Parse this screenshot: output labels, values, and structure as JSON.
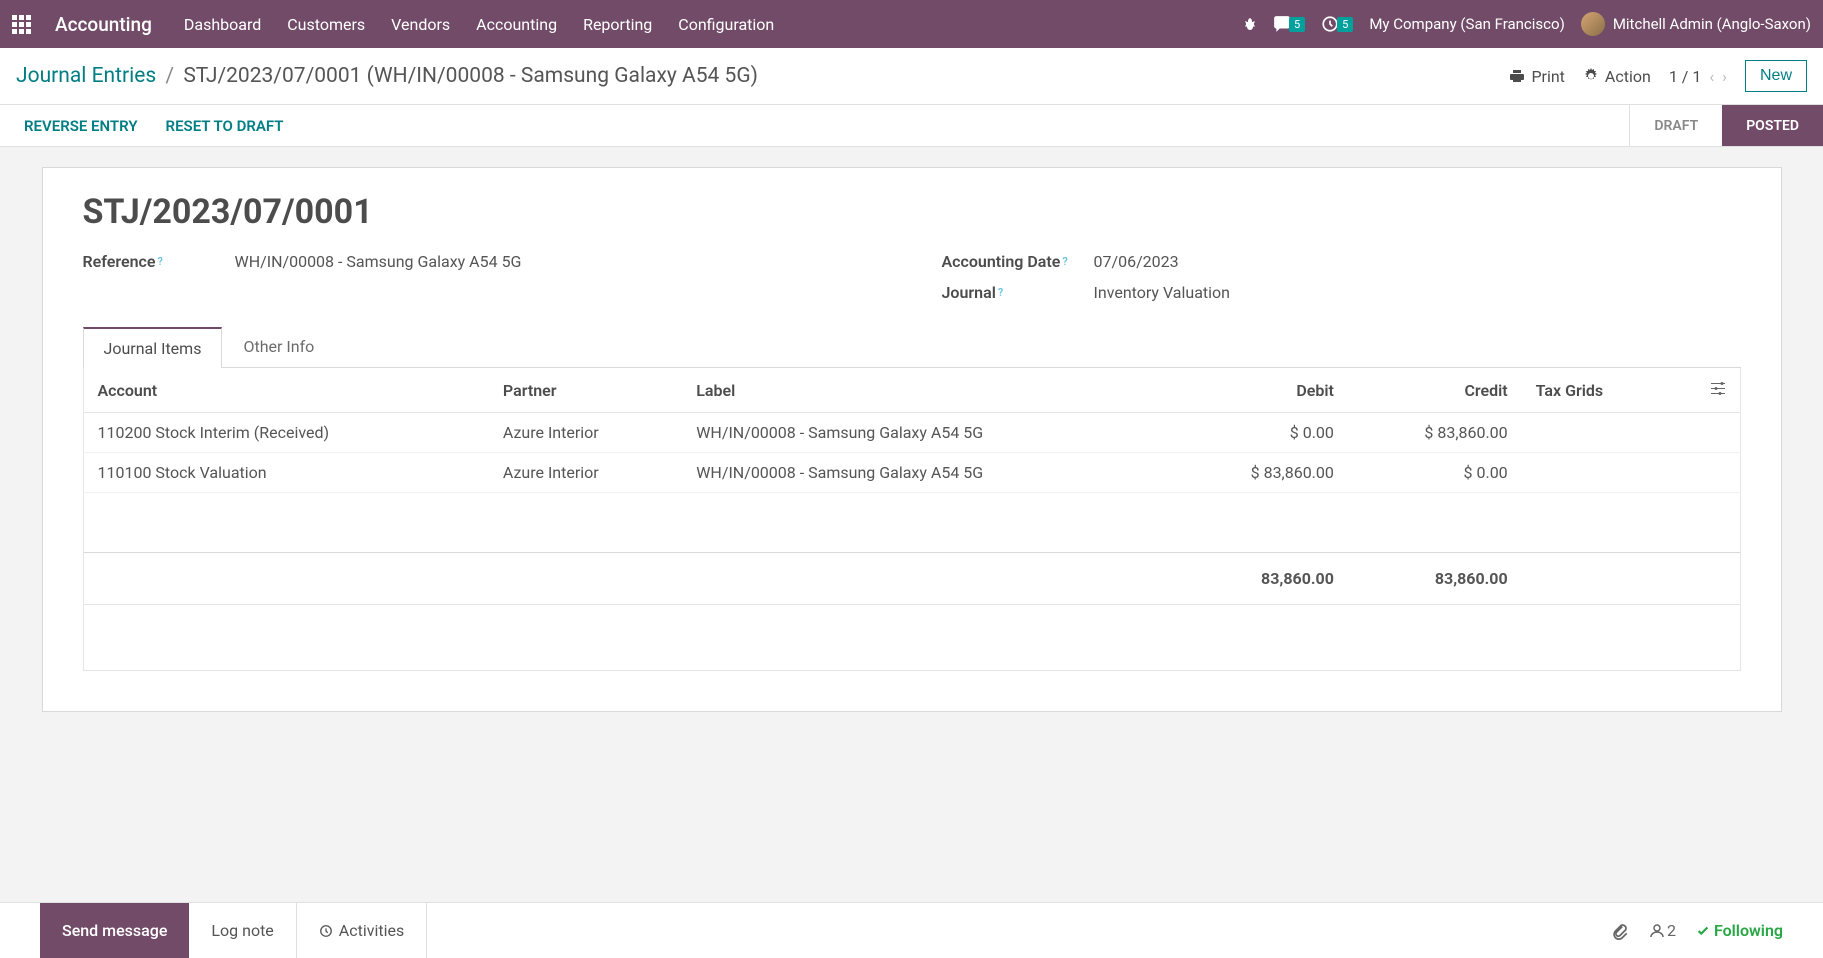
{
  "navbar": {
    "app_name": "Accounting",
    "links": [
      "Dashboard",
      "Customers",
      "Vendors",
      "Accounting",
      "Reporting",
      "Configuration"
    ],
    "msg_badge": "5",
    "activity_badge": "5",
    "company": "My Company (San Francisco)",
    "user": "Mitchell Admin (Anglo-Saxon)"
  },
  "breadcrumb": {
    "root": "Journal Entries",
    "current": "STJ/2023/07/0001 (WH/IN/00008 - Samsung Galaxy A54 5G)"
  },
  "topbar": {
    "print": "Print",
    "action": "Action",
    "pager": "1 / 1",
    "new": "New"
  },
  "actions": {
    "reverse": "REVERSE ENTRY",
    "reset": "RESET TO DRAFT"
  },
  "status": {
    "draft": "DRAFT",
    "posted": "POSTED"
  },
  "entry": {
    "title": "STJ/2023/07/0001",
    "ref_label": "Reference",
    "ref_value": "WH/IN/00008 - Samsung Galaxy A54 5G",
    "date_label": "Accounting Date",
    "date_value": "07/06/2023",
    "journal_label": "Journal",
    "journal_value": "Inventory Valuation"
  },
  "tabs": {
    "items": "Journal Items",
    "other": "Other Info"
  },
  "table": {
    "headers": {
      "account": "Account",
      "partner": "Partner",
      "label": "Label",
      "debit": "Debit",
      "credit": "Credit",
      "tax": "Tax Grids"
    },
    "rows": [
      {
        "account": "110200 Stock Interim (Received)",
        "partner": "Azure Interior",
        "label": "WH/IN/00008 - Samsung Galaxy A54 5G",
        "debit": "$ 0.00",
        "credit": "$ 83,860.00"
      },
      {
        "account": "110100 Stock Valuation",
        "partner": "Azure Interior",
        "label": "WH/IN/00008 - Samsung Galaxy A54 5G",
        "debit": "$ 83,860.00",
        "credit": "$ 0.00"
      }
    ],
    "total_debit": "83,860.00",
    "total_credit": "83,860.00"
  },
  "chatter": {
    "send": "Send message",
    "log": "Log note",
    "activities": "Activities",
    "followers": "2",
    "following": "Following"
  }
}
